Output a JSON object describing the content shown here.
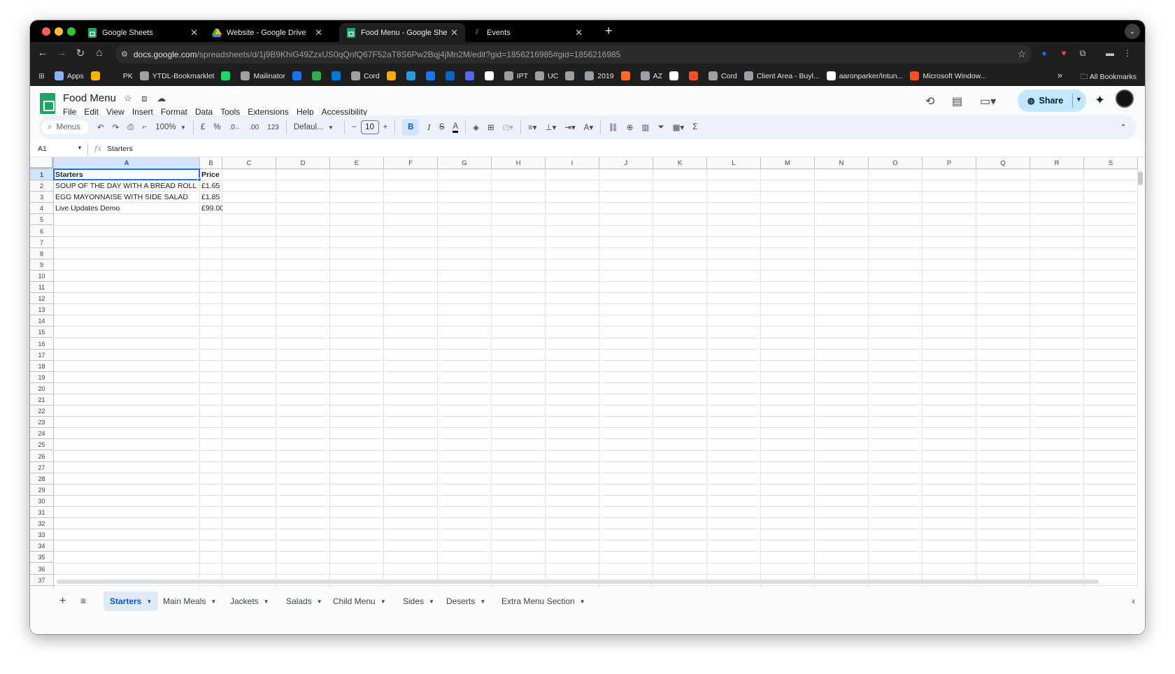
{
  "browser": {
    "tabs": [
      {
        "title": "Google Sheets",
        "icon": "sheets-icon",
        "active": false
      },
      {
        "title": "Website - Google Drive",
        "icon": "drive-icon",
        "active": false
      },
      {
        "title": "Food Menu - Google Sheets",
        "icon": "sheets-icon",
        "active": true
      },
      {
        "title": "Events",
        "icon": "chart-icon",
        "active": false
      }
    ],
    "url_host": "docs.google.com",
    "url_path": "/spreadsheets/d/1j9B9KhiG49ZzxUS0qQnfQ67F52aT8S6Pw2Bqj4jMn2M/edit?gid=1856216985#gid=1856216985",
    "bookmarks": [
      {
        "label": "Apps",
        "color": "#8ab4f8"
      },
      {
        "label": "",
        "color": "#f4b400"
      },
      {
        "label": "PK",
        "color": "#1f1f1f"
      },
      {
        "label": "YTDL-Bookmarklet",
        "color": "#9aa0a6"
      },
      {
        "label": "",
        "color": "#25d366"
      },
      {
        "label": "Mailinator",
        "color": "#9aa0a6"
      },
      {
        "label": "",
        "color": "#1a73e8"
      },
      {
        "label": "",
        "color": "#34a853"
      },
      {
        "label": "",
        "color": "#0078d4"
      },
      {
        "label": "Cord",
        "color": "#9aa0a6"
      },
      {
        "label": "",
        "color": "#f9ab00"
      },
      {
        "label": "",
        "color": "#229ed9"
      },
      {
        "label": "",
        "color": "#1877f2"
      },
      {
        "label": "",
        "color": "#0a66c2"
      },
      {
        "label": "",
        "color": "#5865f2"
      },
      {
        "label": "",
        "color": "#ffffff"
      },
      {
        "label": "IPT",
        "color": "#9aa0a6"
      },
      {
        "label": "UC",
        "color": "#9aa0a6"
      },
      {
        "label": "",
        "color": "#9aa0a6"
      },
      {
        "label": "2019",
        "color": "#9aa0a6"
      },
      {
        "label": "",
        "color": "#fc6d26"
      },
      {
        "label": "AZ",
        "color": "#9aa0a6"
      },
      {
        "label": "",
        "color": "#ffffff"
      },
      {
        "label": "",
        "color": "#f25022"
      },
      {
        "label": "Cord",
        "color": "#9aa0a6"
      },
      {
        "label": "Client Area - Buyl...",
        "color": "#9aa0a6"
      },
      {
        "label": "aaronparker/Intun...",
        "color": "#ffffff"
      },
      {
        "label": "Microsoft Window...",
        "color": "#f25022"
      }
    ],
    "all_bookmarks": "All Bookmarks"
  },
  "doc": {
    "title": "Food Menu",
    "menus": [
      "File",
      "Edit",
      "View",
      "Insert",
      "Format",
      "Data",
      "Tools",
      "Extensions",
      "Help",
      "Accessibility"
    ],
    "share_label": "Share"
  },
  "toolbar": {
    "search": "Menus",
    "zoom": "100%",
    "currency": "£",
    "percent": "%",
    "dec_decrease": ".0←",
    "dec_increase": ".00",
    "number_format": "123",
    "font": "Defaul...",
    "font_size": "10",
    "bold": "B",
    "italic": "I",
    "strike": "S",
    "text_color": "A"
  },
  "formula": {
    "cell_ref": "A1",
    "value": "Starters"
  },
  "grid": {
    "columns": [
      "A",
      "B",
      "C",
      "D",
      "E",
      "F",
      "G",
      "H",
      "I",
      "J",
      "K",
      "L",
      "M",
      "N",
      "O",
      "P",
      "Q",
      "R",
      "S"
    ],
    "row_count": 38,
    "rows": [
      [
        "Starters",
        "Price"
      ],
      [
        "SOUP OF THE DAY WITH A BREAD ROLL",
        "£1.65"
      ],
      [
        "EGG MAYONNAISE WITH SIDE SALAD",
        "£1.85"
      ],
      [
        "Live Updates Demo",
        "£99.00"
      ]
    ],
    "selected_cell": "A1"
  },
  "sheet_tabs": [
    "Starters",
    "Main Meals",
    "Jackets",
    "Salads",
    "Child Menu",
    "Sides",
    "Deserts",
    "Extra Menu Section"
  ],
  "active_sheet": "Starters"
}
